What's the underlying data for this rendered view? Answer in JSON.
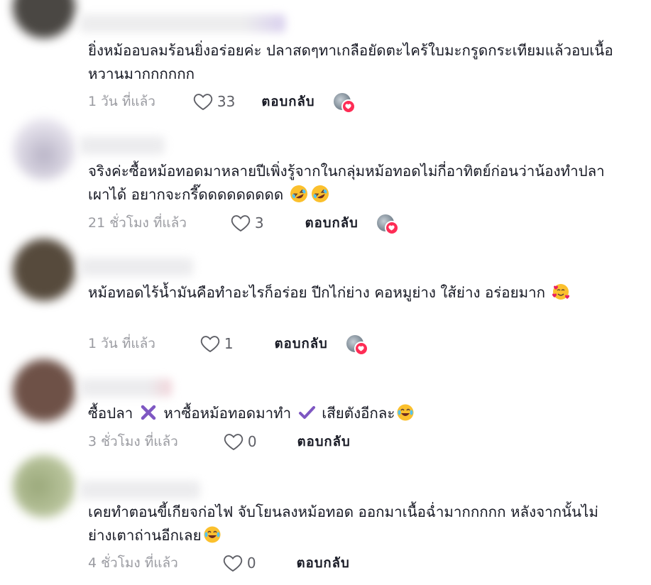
{
  "comments": [
    {
      "text": "ยิ่งหม้ออบลมร้อนยิ่งอร่อยค่ะ ปลาสดๆทาเกลือยัดตะไคร้ใบมะกรูดกระเทียมแล้วอบเนื้อหวานมากกกกกก",
      "time": "1 วัน ที่แล้ว",
      "likes": "33",
      "reply": "ตอบกลับ"
    },
    {
      "text": "จริงค่ะซื้อหม้อทอดมาหลายปีเพิ่งรู้จากในกลุ่มหม้อทอดไม่กี่อาทิตย์ก่อนว่าน้องทำปลาเผาได้ อยากจะกรี๊ดดดดดดดดด",
      "time": "21 ชั่วโมง ที่แล้ว",
      "likes": "3",
      "reply": "ตอบกลับ"
    },
    {
      "text": "หม้อทอดไร้น้ำมันคือทำอะไรก็อร่อย ปีกไก่ย่าง คอหมูย่าง ใส้ย่าง อร่อยมาก",
      "time": "1 วัน ที่แล้ว",
      "likes": "1",
      "reply": "ตอบกลับ"
    },
    {
      "text_part1": "ซื้อปลา",
      "text_part2": "หาซื้อหม้อทอดมาทำ",
      "text_part3": "เสียตังอีกละ",
      "time": "3 ชั่วโมง ที่แล้ว",
      "likes": "0",
      "reply": "ตอบกลับ"
    },
    {
      "text": "เคยทำตอนขี้เกียจก่อไฟ จับโยนลงหม้อทอด ออกมาเนื้อฉ่ำมากกกกก หลังจากนั้นไม่ย่างเตาถ่านอีกเลย",
      "time": "4 ชั่วโมง ที่แล้ว",
      "likes": "0",
      "reply": "ตอบกลับ"
    }
  ],
  "colors": {
    "accent": "#fe2c55",
    "muted": "#9a9ba1",
    "text": "#161823"
  },
  "icons": [
    "heart-outline-icon",
    "creator-liked-icon",
    "rofl-emoji",
    "smiling-hearts-emoji",
    "cross-mark-emoji",
    "check-mark-emoji",
    "joy-emoji"
  ]
}
